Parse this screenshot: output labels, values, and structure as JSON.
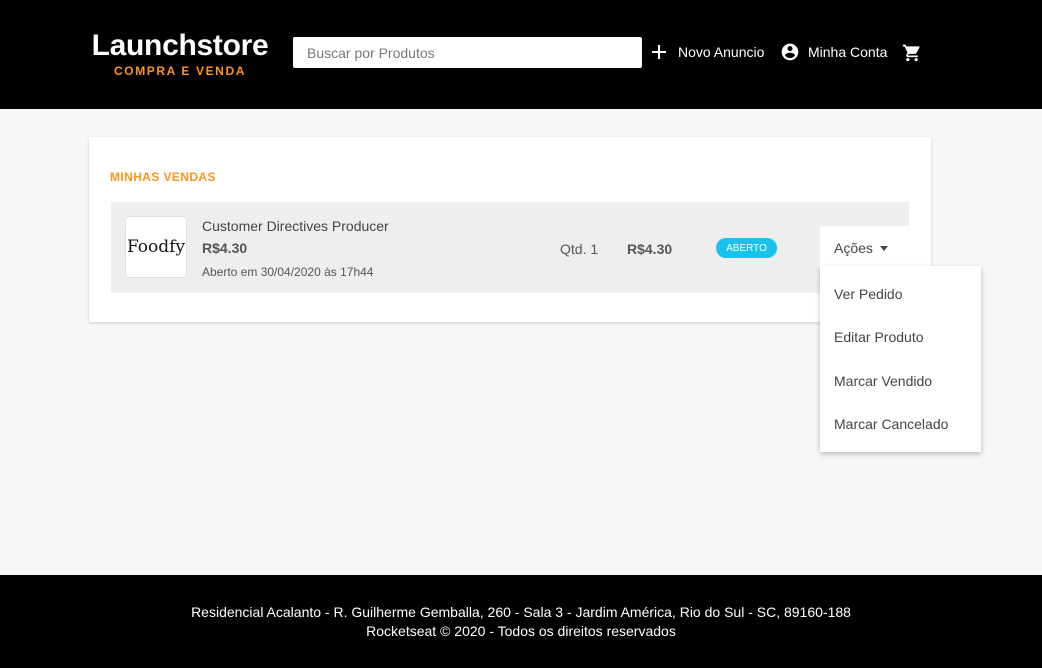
{
  "header": {
    "logo_title": "Launchstore",
    "logo_subtitle": "COMPRA E VENDA",
    "search_placeholder": "Buscar por Produtos",
    "new_ad_label": "Novo Anuncio",
    "account_label": "Minha Conta",
    "icons": {
      "new_ad": "plus-icon",
      "account": "account-circle-icon",
      "cart": "shopping-cart-icon"
    }
  },
  "main": {
    "section_title": "MINHAS VENDAS",
    "order": {
      "thumb_text": "Foodfy",
      "product_name": "Customer Directives Producer",
      "product_price": "R$4.30",
      "opened_at": "Aberto em 30/04/2020 às 17h44",
      "quantity": "Qtd. 1",
      "total": "R$4.30",
      "status": "ABERTO",
      "actions_label": "Ações"
    },
    "actions_menu": [
      "Ver Pedido",
      "Editar Produto",
      "Marcar Vendido",
      "Marcar Cancelado"
    ]
  },
  "footer": {
    "address": "Residencial Acalanto - R. Guilherme Gemballa, 260 - Sala 3 - Jardim América, Rio do Sul - SC, 89160-188",
    "copyright": "Rocketseat © 2020 - Todos os direitos reservados"
  },
  "colors": {
    "accent": "#fd951f",
    "badge": "#19c2ee",
    "header_bg": "#000000",
    "page_bg": "#f7f7f7"
  }
}
